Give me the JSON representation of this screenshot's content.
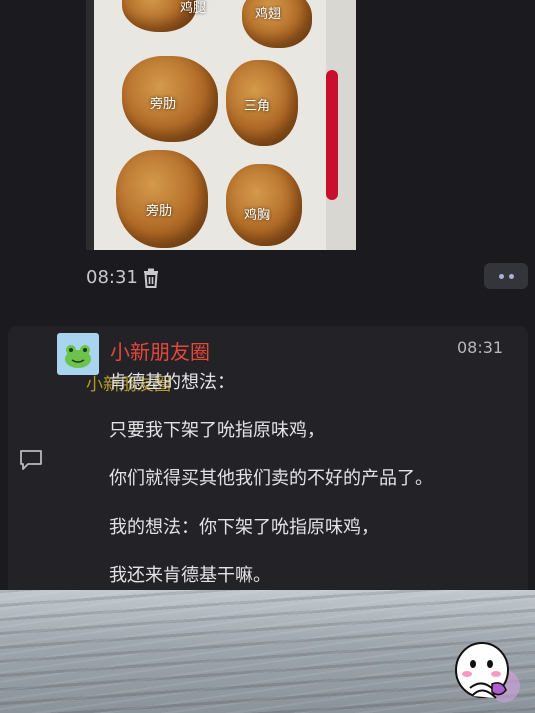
{
  "post": {
    "photo_labels": [
      "鸡腿",
      "鸡翅",
      "旁肋",
      "三角",
      "旁肋",
      "鸡胸"
    ],
    "time": "08:31"
  },
  "icons": {
    "delete": "trash-icon",
    "more": "more-dots-icon",
    "comment": "comment-icon",
    "avatar": "frog-avatar-icon",
    "sticker": "cartoon-sticker-icon"
  },
  "card": {
    "channel_name": "小新朋友圈",
    "time": "08:31",
    "overlay_name": "小新朋友圈",
    "lines": [
      "肯德基的想法：",
      "只要我下架了吮指原味鸡，",
      "你们就得买其他我们卖的不好的产品了。",
      "我的想法：你下架了吮指原味鸡，",
      "我还来肯德基干嘛。"
    ]
  },
  "colors": {
    "background": "#1b1b1f",
    "channel_name": "#e5473a",
    "card": "#232327",
    "more_dots": "#a9b3d6"
  }
}
